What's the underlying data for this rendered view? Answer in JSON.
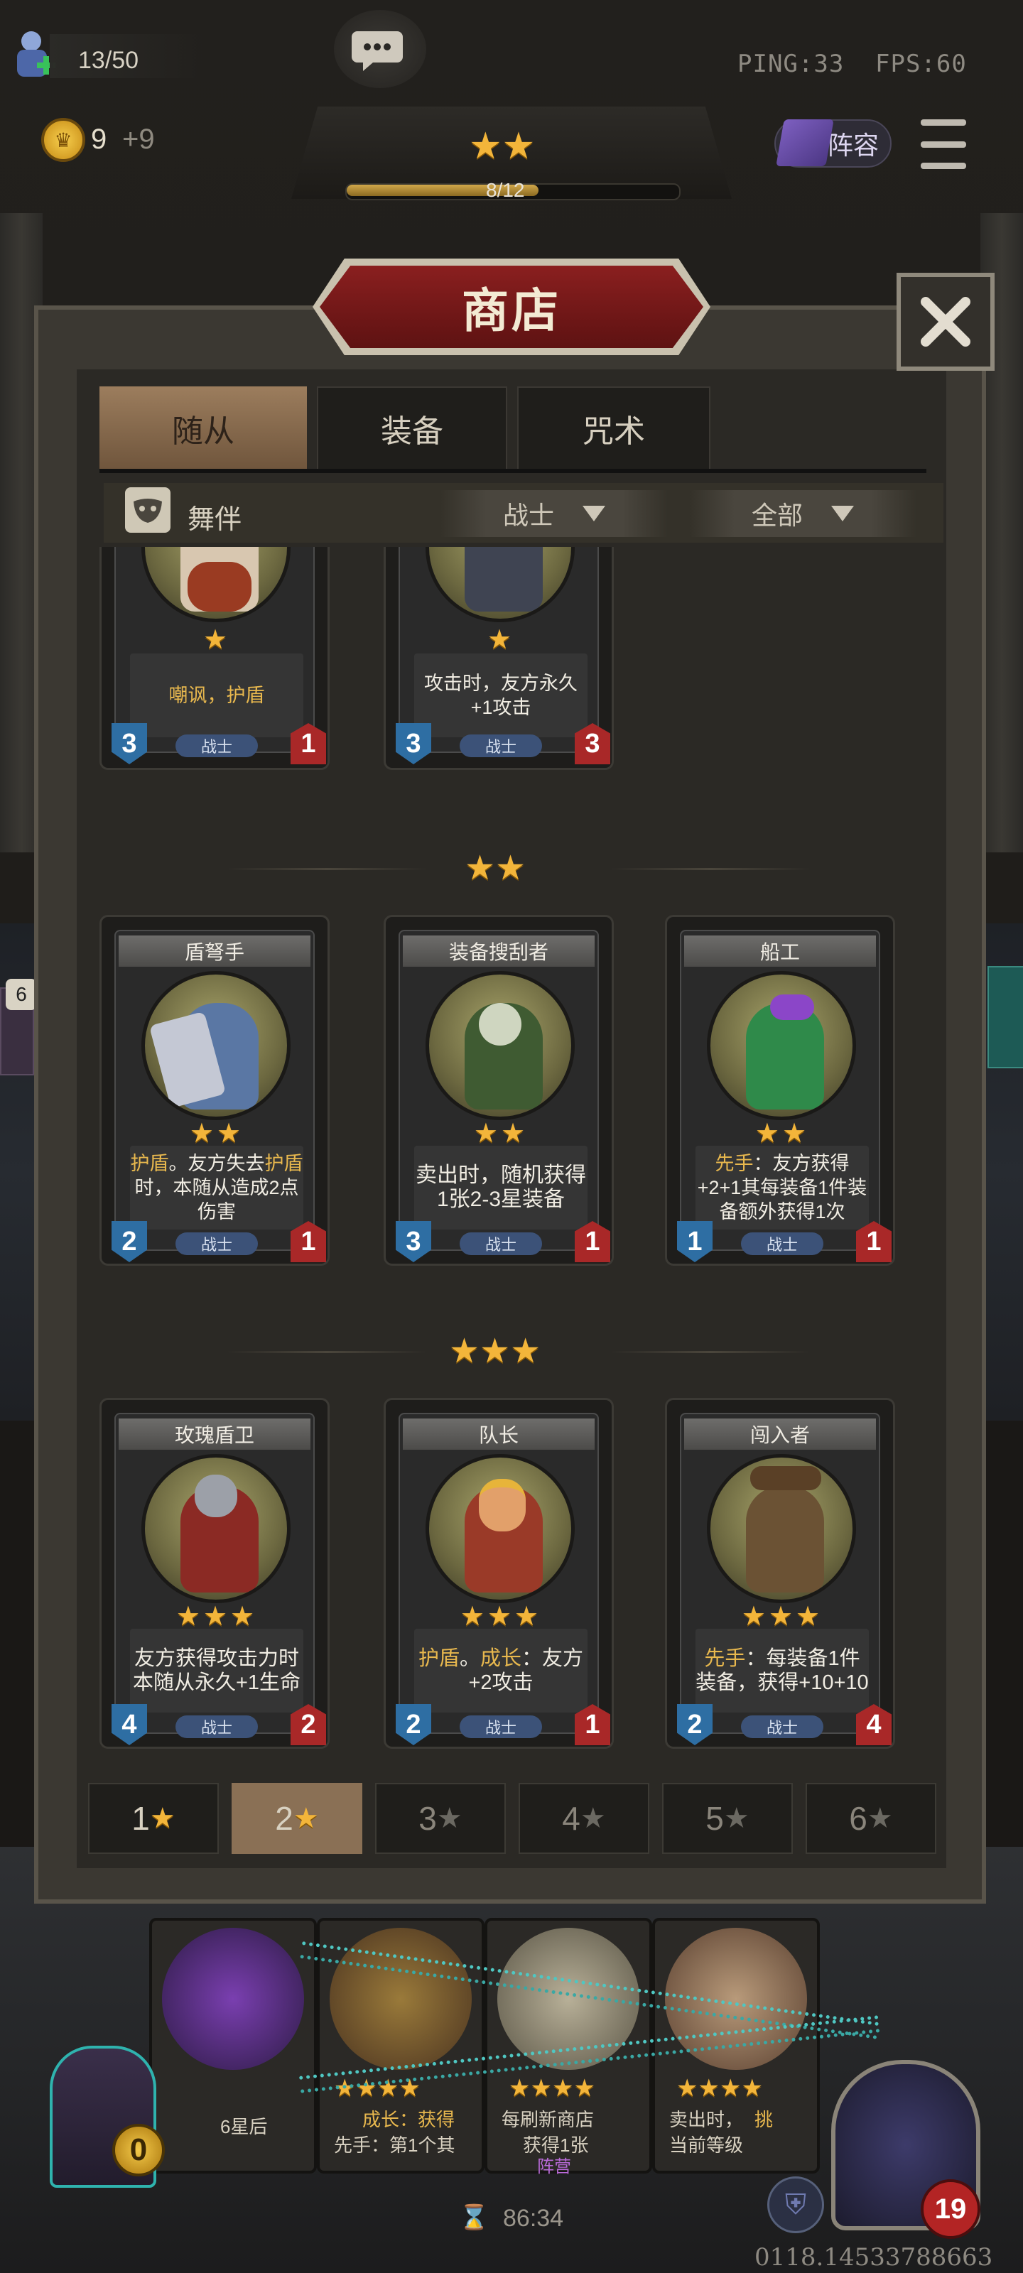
{
  "hud": {
    "population": "13/50",
    "gold": "9",
    "gold_income": "+9",
    "ping": "PING:33",
    "fps": "FPS:60",
    "lineup_label": "阵容",
    "tavern_progress": "8/12",
    "tavern_level_stars": 2
  },
  "shop": {
    "title": "商店",
    "tabs": [
      {
        "label": "随从",
        "active": true
      },
      {
        "label": "装备",
        "active": false
      },
      {
        "label": "咒术",
        "active": false
      }
    ],
    "filter_tag": "舞伴",
    "filter_tribe": "战士",
    "filter_scope": "全部",
    "tiers": [
      {
        "stars": 1,
        "cards": [
          {
            "name": "",
            "desc": "嘲讽，护盾",
            "attack": "3",
            "health": "1",
            "tribe": "战士"
          },
          {
            "name": "",
            "desc": "攻击时，友方永久+1攻击",
            "attack": "3",
            "health": "3",
            "tribe": "战士"
          }
        ]
      },
      {
        "stars": 2,
        "cards": [
          {
            "name": "盾弩手",
            "desc_kw": "护盾",
            "desc": "。友方失去",
            "desc_kw2": "护盾",
            "desc2": "时，本随从造成2点伤害",
            "attack": "2",
            "health": "1",
            "tribe": "战士"
          },
          {
            "name": "装备搜刮者",
            "desc": "卖出时，随机获得1张2-3星装备",
            "attack": "3",
            "health": "1",
            "tribe": "战士"
          },
          {
            "name": "船工",
            "desc_kw": "先手",
            "desc": "：友方获得+2+1其每装备1件装备额外获得1次",
            "attack": "1",
            "health": "1",
            "tribe": "战士"
          }
        ]
      },
      {
        "stars": 3,
        "cards": [
          {
            "name": "玫瑰盾卫",
            "desc": "友方获得攻击力时本随从永久+1生命",
            "attack": "4",
            "health": "2",
            "tribe": "战士"
          },
          {
            "name": "队长",
            "desc_kw": "护盾",
            "desc_mid": "。",
            "desc_kw2": "成长",
            "desc": "：友方+2攻击",
            "attack": "2",
            "health": "1",
            "tribe": "战士"
          },
          {
            "name": "闯入者",
            "desc_kw": "先手",
            "desc": "：每装备1件装备，获得+10+10",
            "attack": "2",
            "health": "4",
            "tribe": "战士"
          }
        ]
      }
    ],
    "tier_tabs": [
      {
        "label": "1",
        "active": false,
        "unlocked": true
      },
      {
        "label": "2",
        "active": true,
        "unlocked": true
      },
      {
        "label": "3",
        "active": false,
        "unlocked": false
      },
      {
        "label": "4",
        "active": false,
        "unlocked": false
      },
      {
        "label": "5",
        "active": false,
        "unlocked": false
      },
      {
        "label": "6",
        "active": false,
        "unlocked": false
      }
    ]
  },
  "bottom": {
    "left_counter": "0",
    "timer": "86:34",
    "hero_health": "19",
    "version": "0118.14533788663",
    "hand_texts": [
      "6星后",
      "成长：获得",
      "先手：第1个其",
      "每刷新商店",
      "获得1张",
      "卖出时，",
      "当前等级"
    ],
    "hand_kw": [
      "阵营",
      "挑"
    ],
    "side_badge": "6"
  },
  "colors": {
    "accent_gold": "#f3b53a",
    "keyword": "#e8b84e",
    "attack_blue": "#2e6ea3",
    "health_red": "#a92828",
    "banner_red": "#8a1f1f"
  },
  "icons": [
    "population-icon",
    "chat-icon",
    "coin-icon",
    "lineup-icon",
    "menu-icon",
    "close-icon",
    "mask-icon",
    "dropdown-icon",
    "star-icon",
    "hourglass-icon",
    "shield-icon",
    "heart-icon"
  ]
}
